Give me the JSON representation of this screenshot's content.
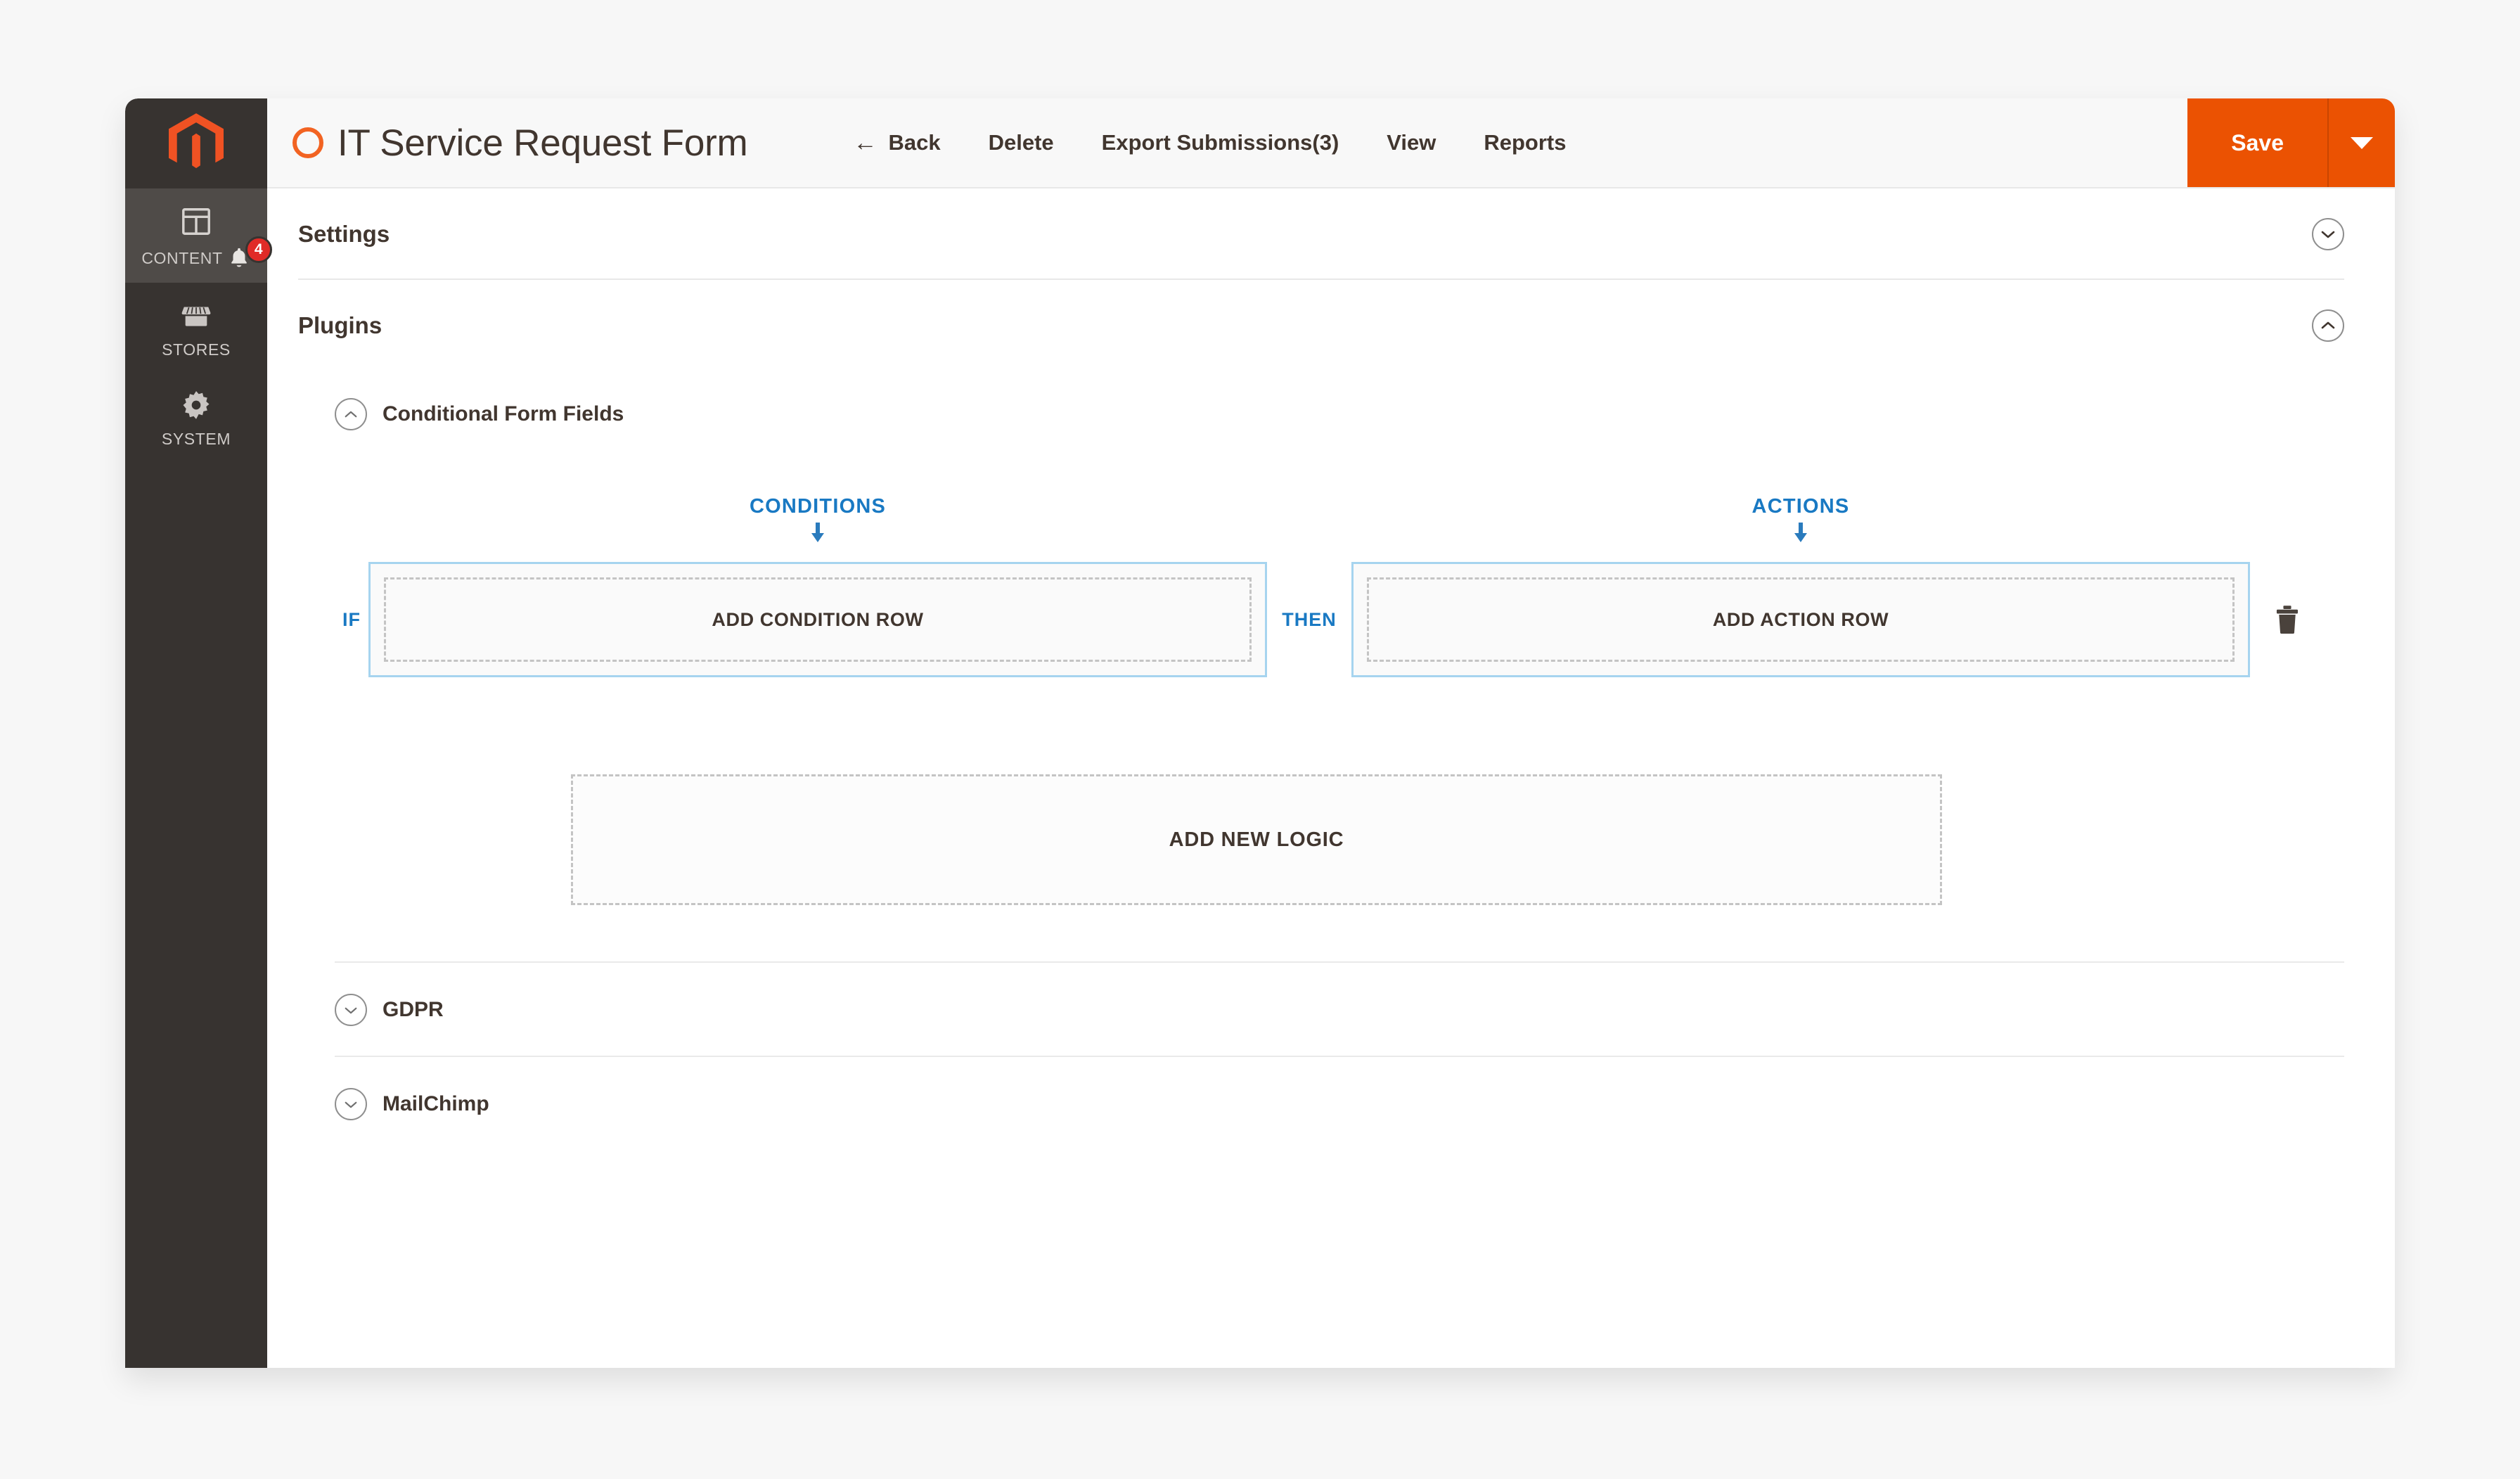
{
  "brand": {
    "logo_icon": "magento-logo-icon",
    "accent_orange": "#eb5202",
    "logo_orange": "#f05223",
    "accent_blue": "#1979c3",
    "sidebar_bg": "#373330"
  },
  "sidebar": {
    "items": [
      {
        "label": "CONTENT",
        "icon": "content-layout-icon",
        "active": true,
        "badge": "4",
        "badge_icon": "bell-icon"
      },
      {
        "label": "STORES",
        "icon": "store-icon",
        "active": false
      },
      {
        "label": "SYSTEM",
        "icon": "gear-icon",
        "active": false
      }
    ]
  },
  "header": {
    "title": "IT Service Request Form",
    "title_icon": "orange-ring-icon",
    "actions": [
      {
        "label": "Back",
        "icon": "arrow-left-icon"
      },
      {
        "label": "Delete",
        "icon": ""
      },
      {
        "label": "Export Submissions(3)",
        "icon": ""
      },
      {
        "label": "View",
        "icon": ""
      },
      {
        "label": "Reports",
        "icon": ""
      }
    ],
    "save": {
      "label": "Save",
      "caret_icon": "caret-down-icon"
    }
  },
  "sections": [
    {
      "title": "Settings",
      "expanded": false,
      "chevron": "chevron-down-icon"
    },
    {
      "title": "Plugins",
      "expanded": true,
      "chevron": "chevron-up-icon"
    }
  ],
  "plugins": {
    "conditional_form_fields": {
      "title": "Conditional Form Fields",
      "expanded": true,
      "chevron": "chevron-up-icon",
      "columns": {
        "conditions_label": "CONDITIONS",
        "actions_label": "ACTIONS",
        "arrow_icon": "arrow-down-icon"
      },
      "rule": {
        "if_label": "IF",
        "then_label": "THEN",
        "add_condition_label": "ADD CONDITION ROW",
        "add_action_label": "ADD ACTION ROW",
        "delete_icon": "trash-icon"
      },
      "add_new_logic_label": "ADD NEW LOGIC"
    },
    "others": [
      {
        "title": "GDPR",
        "expanded": false,
        "chevron": "chevron-down-icon"
      },
      {
        "title": "MailChimp",
        "expanded": false,
        "chevron": "chevron-down-icon"
      }
    ]
  }
}
